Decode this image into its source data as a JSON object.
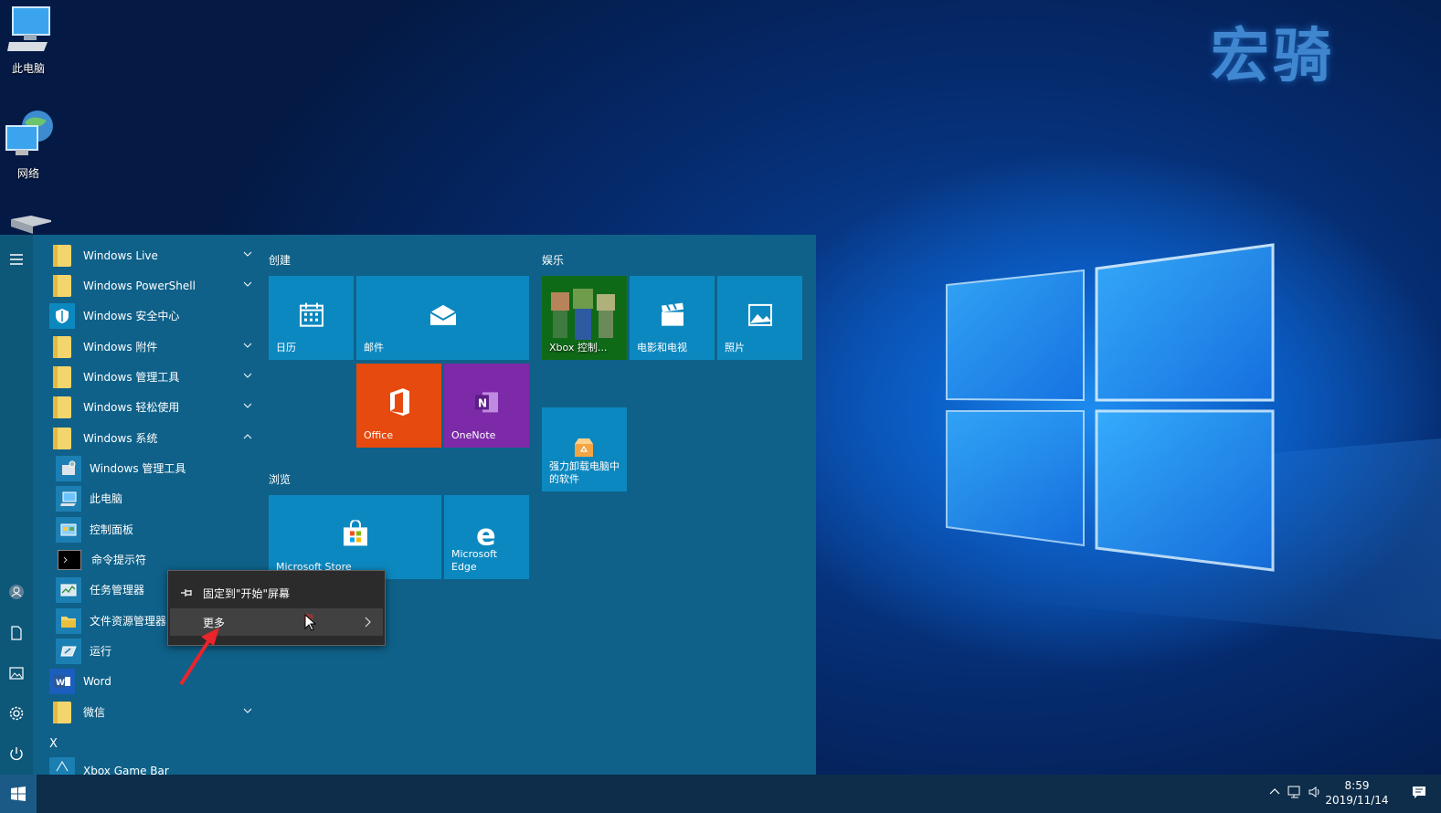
{
  "desktop": {
    "watermark": "宏骑",
    "icons": [
      {
        "label": "此电脑",
        "icon": "computer-icon"
      },
      {
        "label": "网络",
        "icon": "network-icon"
      }
    ]
  },
  "applist": {
    "items": [
      {
        "label": "Windows Live",
        "type": "folder",
        "expand": "down"
      },
      {
        "label": "Windows PowerShell",
        "type": "folder",
        "expand": "down"
      },
      {
        "label": "Windows 安全中心",
        "type": "shield"
      },
      {
        "label": "Windows 附件",
        "type": "folder",
        "expand": "down"
      },
      {
        "label": "Windows 管理工具",
        "type": "folder",
        "expand": "down"
      },
      {
        "label": "Windows 轻松使用",
        "type": "folder",
        "expand": "down"
      },
      {
        "label": "Windows 系统",
        "type": "folder",
        "expand": "up"
      },
      {
        "label": "Windows 管理工具",
        "type": "admin-tools",
        "sub": true
      },
      {
        "label": "此电脑",
        "type": "computer",
        "sub": true
      },
      {
        "label": "控制面板",
        "type": "control-panel",
        "sub": true
      },
      {
        "label": "命令提示符",
        "type": "cmd",
        "sub": true
      },
      {
        "label": "任务管理器",
        "type": "task-manager",
        "sub": true
      },
      {
        "label": "文件资源管理器",
        "type": "explorer",
        "sub": true
      },
      {
        "label": "运行",
        "type": "run",
        "sub": true
      },
      {
        "label": "Word",
        "type": "word"
      },
      {
        "label": "微信",
        "type": "folder",
        "expand": "down"
      }
    ],
    "section_letter": "X",
    "last_item": "Xbox Game Bar"
  },
  "groups": {
    "create": "创建",
    "entertain": "娱乐",
    "browse": "浏览"
  },
  "tiles": {
    "calendar": "日历",
    "mail": "邮件",
    "office": "Office",
    "onenote": "OneNote",
    "xbox": "Xbox 控制...",
    "movies": "电影和电视",
    "photos": "照片",
    "uninstall": "强力卸载电脑中的软件",
    "store": "Microsoft Store",
    "edge": "Microsoft Edge"
  },
  "context_menu": {
    "pin": "固定到\"开始\"屏幕",
    "more": "更多"
  },
  "taskbar": {
    "time": "8:59",
    "date": "2019/11/14"
  },
  "colors": {
    "start_bg": "#0f6189",
    "tile_blue": "#0c88c0",
    "office": "#e64a0e",
    "onenote": "#7d2aa8",
    "xbox": "#107c10"
  }
}
